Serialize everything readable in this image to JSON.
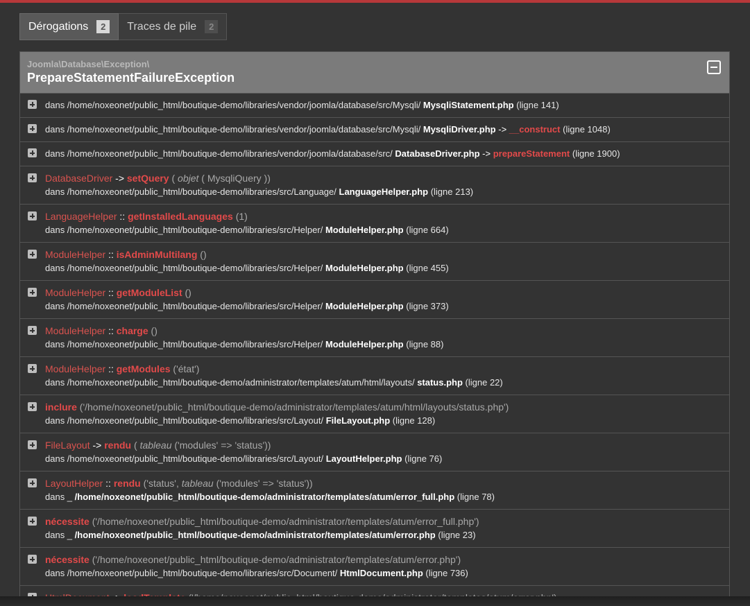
{
  "tabs": [
    {
      "label": "Dérogations",
      "count": "2"
    },
    {
      "label": "Traces de pile",
      "count": "2"
    }
  ],
  "exception": {
    "namespace": "Joomla\\Database\\Exception\\",
    "name": "PrepareStatementFailureException"
  },
  "frames": [
    {
      "type": "one",
      "prefix": "dans /home/noxeonet/public_html/boutique-demo/libraries/vendor/joomla/database/src/Mysqli/",
      "file": "MysqliStatement.php",
      "op": "",
      "fn": "",
      "line": "(ligne 141)"
    },
    {
      "type": "one",
      "prefix": "dans /home/noxeonet/public_html/boutique-demo/libraries/vendor/joomla/database/src/Mysqli/",
      "file": "MysqliDriver.php",
      "op": "->",
      "fn": "__construct",
      "line": "(ligne 1048)"
    },
    {
      "type": "one",
      "prefix": "dans /home/noxeonet/public_html/boutique-demo/libraries/vendor/joomla/database/src/",
      "file": "DatabaseDriver.php",
      "op": "->",
      "fn": "prepareStatement",
      "line": "(ligne 1900)"
    },
    {
      "type": "two",
      "cls": "DatabaseDriver",
      "op": "->",
      "fn": "setQuery",
      "args_pre": "(",
      "args_it": "objet",
      "args_post": "( MysqliQuery ))",
      "prefix": "dans /home/noxeonet/public_html/boutique-demo/libraries/src/Language/",
      "file": "LanguageHelper.php",
      "line": "(ligne 213)"
    },
    {
      "type": "two",
      "cls": "LanguageHelper",
      "op": "::",
      "fn": "getInstalledLanguages",
      "args_pre": "(1)",
      "args_it": "",
      "args_post": "",
      "prefix": "dans /home/noxeonet/public_html/boutique-demo/libraries/src/Helper/",
      "file": "ModuleHelper.php",
      "line": "(ligne 664)"
    },
    {
      "type": "two",
      "cls": "ModuleHelper",
      "op": "::",
      "fn": "isAdminMultilang",
      "args_pre": "()",
      "args_it": "",
      "args_post": "",
      "prefix": "dans /home/noxeonet/public_html/boutique-demo/libraries/src/Helper/",
      "file": "ModuleHelper.php",
      "line": "(ligne 455)"
    },
    {
      "type": "two",
      "cls": "ModuleHelper",
      "op": "::",
      "fn": "getModuleList",
      "args_pre": "()",
      "args_it": "",
      "args_post": "",
      "prefix": "dans /home/noxeonet/public_html/boutique-demo/libraries/src/Helper/",
      "file": "ModuleHelper.php",
      "line": "(ligne 373)"
    },
    {
      "type": "two",
      "cls": "ModuleHelper",
      "op": "::",
      "fn": "charge",
      "args_pre": "()",
      "args_it": "",
      "args_post": "",
      "prefix": "dans /home/noxeonet/public_html/boutique-demo/libraries/src/Helper/",
      "file": "ModuleHelper.php",
      "line": "(ligne 88)"
    },
    {
      "type": "two",
      "cls": "ModuleHelper",
      "op": "::",
      "fn": "getModules",
      "args_pre": "('état')",
      "args_it": "",
      "args_post": "",
      "prefix": "dans /home/noxeonet/public_html/boutique-demo/administrator/templates/atum/html/layouts/",
      "file": "status.php",
      "line": "(ligne 22)"
    },
    {
      "type": "two",
      "cls": "",
      "op": "",
      "fn": "inclure",
      "args_pre": "('/home/noxeonet/public_html/boutique-demo/administrator/templates/atum/html/layouts/status.php')",
      "args_it": "",
      "args_post": "",
      "prefix": "dans /home/noxeonet/public_html/boutique-demo/libraries/src/Layout/",
      "file": "FileLayout.php",
      "line": "(ligne 128)"
    },
    {
      "type": "two",
      "cls": "FileLayout",
      "op": "->",
      "fn": "rendu",
      "args_pre": "(",
      "args_it": "tableau",
      "args_post": "('modules' => 'status'))",
      "prefix": "dans /home/noxeonet/public_html/boutique-demo/libraries/src/Layout/",
      "file": "LayoutHelper.php",
      "line": "(ligne 76)"
    },
    {
      "type": "two",
      "cls": "LayoutHelper",
      "op": "::",
      "fn": "rendu",
      "args_pre": "('status',",
      "args_it": "tableau",
      "args_post": "('modules' => 'status'))",
      "prefix": "dans _",
      "file": "/home/noxeonet/public_html/boutique-demo/administrator/templates/atum/error_full.php",
      "line": "(ligne 78)"
    },
    {
      "type": "two",
      "cls": "",
      "op": "",
      "fn": "nécessite",
      "args_pre": "('/home/noxeonet/public_html/boutique-demo/administrator/templates/atum/error_full.php')",
      "args_it": "",
      "args_post": "",
      "prefix": "dans _",
      "file": "/home/noxeonet/public_html/boutique-demo/administrator/templates/atum/error.php",
      "line": "(ligne 23)"
    },
    {
      "type": "two",
      "cls": "",
      "op": "",
      "fn": "nécessite",
      "args_pre": "('/home/noxeonet/public_html/boutique-demo/administrator/templates/atum/error.php')",
      "args_it": "",
      "args_post": "",
      "prefix": "dans /home/noxeonet/public_html/boutique-demo/libraries/src/Document/",
      "file": "HtmlDocument.php",
      "line": "(ligne 736)"
    },
    {
      "type": "two",
      "cls": "HtmlDocument",
      "op": "->",
      "fn": "loadTemplate",
      "args_pre": "('/home/noxeonet/public_html/boutique-demo/administrator/templates/atum/error.php')",
      "args_it": "",
      "args_post": "",
      "prefix": "",
      "file": "",
      "line": ""
    }
  ]
}
